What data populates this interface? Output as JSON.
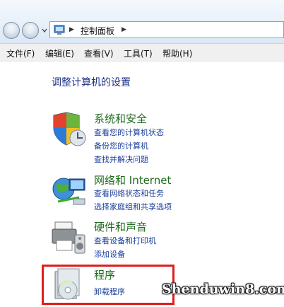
{
  "address": {
    "path": "控制面板"
  },
  "menu": {
    "file": "文件(F)",
    "edit": "编辑(E)",
    "view": "查看(V)",
    "tools": "工具(T)",
    "help": "帮助(H)"
  },
  "page_title": "调整计算机的设置",
  "categories": [
    {
      "title": "系统和安全",
      "icon": "shield-icon",
      "links": [
        "查看您的计算机状态",
        "备份您的计算机",
        "查找并解决问题"
      ]
    },
    {
      "title": "网络和 Internet",
      "icon": "network-globe-icon",
      "links": [
        "查看网络状态和任务",
        "选择家庭组和共享选项"
      ]
    },
    {
      "title": "硬件和声音",
      "icon": "printer-speaker-icon",
      "links": [
        "查看设备和打印机",
        "添加设备"
      ]
    },
    {
      "title": "程序",
      "icon": "programs-disc-icon",
      "links": [
        "卸载程序"
      ]
    }
  ],
  "watermark": "Shenduwin8.com",
  "colors": {
    "title_blue": "#1e3287",
    "category_green": "#1e6b1e",
    "link_blue": "#1a3e9a",
    "highlight_red": "#e01d1d"
  }
}
